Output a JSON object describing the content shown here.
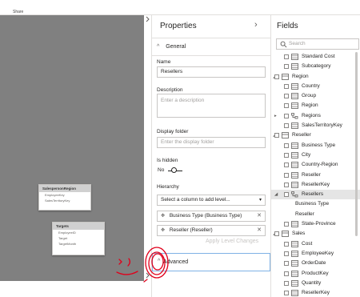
{
  "ribbon": {
    "share_label": "Share"
  },
  "canvas": {
    "tables": [
      {
        "name": "SalespersonRegion",
        "fields": [
          "EmployeeKey",
          "SalesTerritoryKey"
        ]
      },
      {
        "name": "Targets",
        "fields": [
          "EmployeeID",
          "Target",
          "TargetMonth"
        ]
      }
    ]
  },
  "properties": {
    "title": "Properties",
    "general_label": "General",
    "name_label": "Name",
    "name_value": "Resellers",
    "description_label": "Description",
    "description_placeholder": "Enter a description",
    "display_folder_label": "Display folder",
    "display_folder_placeholder": "Enter the display folder",
    "is_hidden_label": "Is hidden",
    "is_hidden_value": "No",
    "hierarchy_label": "Hierarchy",
    "select_placeholder": "Select a column to add level...",
    "levels": [
      "Business Type (Business Type)",
      "Reseller (Reseller)"
    ],
    "apply_label": "Apply Level Changes",
    "advanced_label": "Advanced"
  },
  "fields": {
    "title": "Fields",
    "search_placeholder": "Search",
    "items": [
      {
        "label": "Standard Cost",
        "kind": "field",
        "level": 1
      },
      {
        "label": "Subcategory",
        "kind": "field",
        "level": 1
      },
      {
        "label": "Region",
        "kind": "table",
        "level": 0,
        "expanded": true
      },
      {
        "label": "Country",
        "kind": "field",
        "level": 1
      },
      {
        "label": "Group",
        "kind": "field",
        "level": 1
      },
      {
        "label": "Region",
        "kind": "field",
        "level": 1
      },
      {
        "label": "Regions",
        "kind": "hierarchy",
        "level": 1,
        "expanded": false
      },
      {
        "label": "SalesTerritoryKey",
        "kind": "field",
        "level": 1
      },
      {
        "label": "Reseller",
        "kind": "table",
        "level": 0,
        "expanded": true
      },
      {
        "label": "Business Type",
        "kind": "field",
        "level": 1
      },
      {
        "label": "City",
        "kind": "field",
        "level": 1
      },
      {
        "label": "Country-Region",
        "kind": "field",
        "level": 1
      },
      {
        "label": "Reseller",
        "kind": "field",
        "level": 1
      },
      {
        "label": "ResellerKey",
        "kind": "field",
        "level": 1
      },
      {
        "label": "Resellers",
        "kind": "hierarchy",
        "level": 1,
        "expanded": true,
        "selected": true
      },
      {
        "label": "Business Type",
        "kind": "level",
        "level": 2
      },
      {
        "label": "Reseller",
        "kind": "level",
        "level": 2
      },
      {
        "label": "State-Province",
        "kind": "field",
        "level": 1
      },
      {
        "label": "Sales",
        "kind": "table",
        "level": 0,
        "expanded": true
      },
      {
        "label": "Cost",
        "kind": "field",
        "level": 1
      },
      {
        "label": "EmployeeKey",
        "kind": "field",
        "level": 1
      },
      {
        "label": "OrderDate",
        "kind": "field",
        "level": 1
      },
      {
        "label": "ProductKey",
        "kind": "field",
        "level": 1
      },
      {
        "label": "Quantity",
        "kind": "field",
        "level": 1
      },
      {
        "label": "ResellerKey",
        "kind": "field",
        "level": 1
      }
    ]
  },
  "colors": {
    "canvas": "#808080",
    "annotation": "#e0001b",
    "selection": "#e5e5e5",
    "focus_border": "#7fb2e5"
  }
}
